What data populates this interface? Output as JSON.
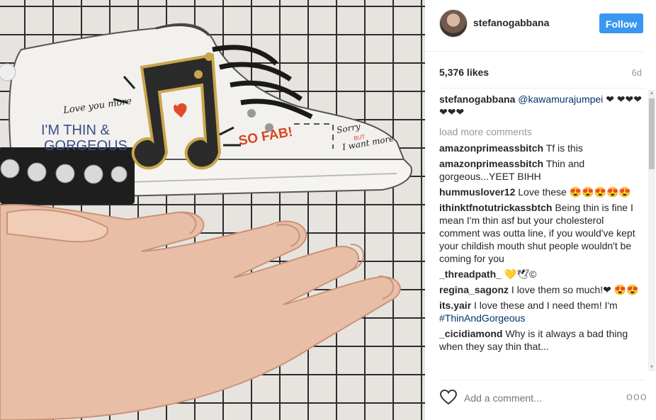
{
  "post": {
    "image_alt": "Illustrated sneaker balanced on fingertips",
    "sneaker_texts": {
      "love": "Love you more",
      "thin": "I'M THIN &",
      "gorgeous": "GORGEOUS",
      "sofab": "SO FAB!",
      "sorry": "Sorry",
      "but": "BUT",
      "iwant": "I want more"
    }
  },
  "header": {
    "username": "stefanogabbana",
    "follow_label": "Follow"
  },
  "stats": {
    "likes": "5,376 likes",
    "time_ago": "6d"
  },
  "caption": {
    "user": "stefanogabbana",
    "mention": "@kawamurajumpei",
    "hearts": "❤ ❤❤❤❤❤❤"
  },
  "load_more": "load more comments",
  "comments": [
    {
      "user": "amazonprimeassbitch",
      "text": "Tf is this"
    },
    {
      "user": "amazonprimeassbitch",
      "text": "Thin and gorgeous...YEET BIHH"
    },
    {
      "user": "hummuslover12",
      "text": "Love these 😍😍😍😍😍"
    },
    {
      "user": "ithinktfnotutrickassbtch",
      "text": "Being thin is fine I mean I'm thin asf but your cholesterol comment was outta line, if you would've kept your childish mouth shut people wouldn't be coming for you"
    },
    {
      "user": "_threadpath_",
      "text": "💛🕊©"
    },
    {
      "user": "regina_sagonz",
      "text": "I love them so much!❤ 😍😍"
    },
    {
      "user": "its.yair",
      "text": "I love these and I need them! I'm",
      "hashtag": "#ThinAndGorgeous"
    },
    {
      "user": "_cicidiamond",
      "text": "Why is it always a bad thing when they say thin that..."
    }
  ],
  "footer": {
    "comment_placeholder": "Add a comment...",
    "more_label": "ooo"
  },
  "colors": {
    "follow_bg": "#3897f0",
    "link": "#003569",
    "muted": "#999999"
  }
}
